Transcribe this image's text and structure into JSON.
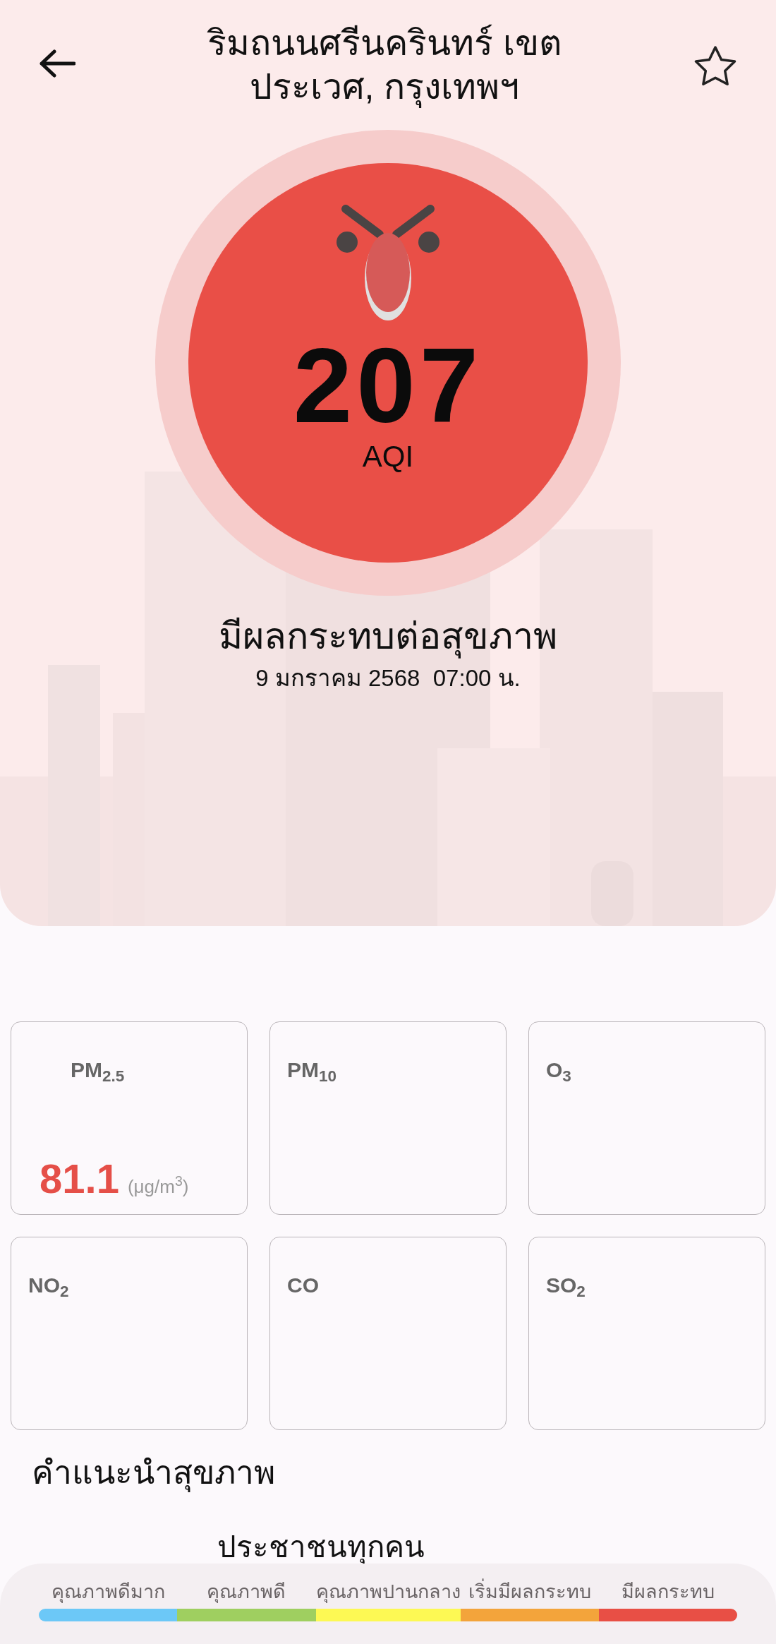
{
  "header": {
    "title_lines": [
      "ริมถนนศรีนครินทร์ เขต",
      "ประเวศ, กรุงเทพฯ"
    ],
    "favorite": false
  },
  "aqi": {
    "value": "207",
    "unit": "AQI",
    "status": "มีผลกระทบต่อสุขภาพ",
    "datetime": "9 มกราคม 2568  07:00 น."
  },
  "pollutants": [
    {
      "name": "PM$_{2.5}$",
      "value": "81.1",
      "unit": "(μg/m$^{3}$)"
    },
    {
      "name": "PM$_{10}$"
    },
    {
      "name": "O$_{3}$"
    },
    {
      "name": "NO$_{2}$"
    },
    {
      "name": "CO"
    },
    {
      "name": "SO$_{2}$"
    }
  ],
  "health_advice": {
    "title": "คำแนะนำสุขภาพ",
    "text": "ประชาชนทุกคน"
  },
  "legend": [
    {
      "label": "คุณภาพดีมาก",
      "color": "#6cc8f7"
    },
    {
      "label": "คุณภาพดี",
      "color": "#9fcf60"
    },
    {
      "label": "คุณภาพปานกลาง",
      "color": "#fdf954"
    },
    {
      "label": "เริ่มมีผลกระทบ",
      "color": "#f3a43b"
    },
    {
      "label": "มีผลกระทบ",
      "color": "#e84f45"
    }
  ]
}
